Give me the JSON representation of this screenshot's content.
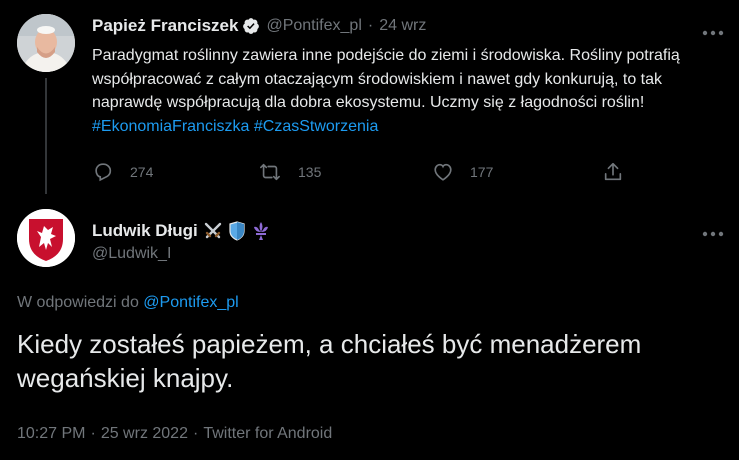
{
  "colors": {
    "background": "#000000",
    "text": "#e7e9ea",
    "muted": "#71767b",
    "accent": "#1d9bf0"
  },
  "tweet1": {
    "name": "Papież Franciszek",
    "handle": "@Pontifex_pl",
    "separator": "·",
    "time": "24 wrz",
    "verified_icon": "verified-badge-icon",
    "text": "Paradygmat roślinny zawiera inne podejście do ziemi i środowiska. Rośliny potrafią współpracować z całym otaczającym środowiskiem i nawet gdy konkurują, to tak naprawdę współpracują dla dobra ekosystemu. Uczmy się z łagodności roślin! ",
    "hashtags": [
      "#EkonomiaFranciszka",
      "#CzasStworzenia"
    ],
    "actions": {
      "reply_count": "274",
      "retweet_count": "135",
      "like_count": "177"
    }
  },
  "tweet2": {
    "name": "Ludwik Długi",
    "handle": "@Ludwik_I",
    "name_emojis": [
      "crossed-swords-icon",
      "shield-icon",
      "fleur-de-lis-icon"
    ],
    "reply_prefix": "W odpowiedzi do ",
    "reply_to": "@Pontifex_pl",
    "text": "Kiedy zostałeś papieżem, a chciałeś być menadżerem wegańskiej knajpy.",
    "time": "10:27 PM",
    "date": "25 wrz 2022",
    "separator": "·",
    "source": "Twitter for Android"
  }
}
